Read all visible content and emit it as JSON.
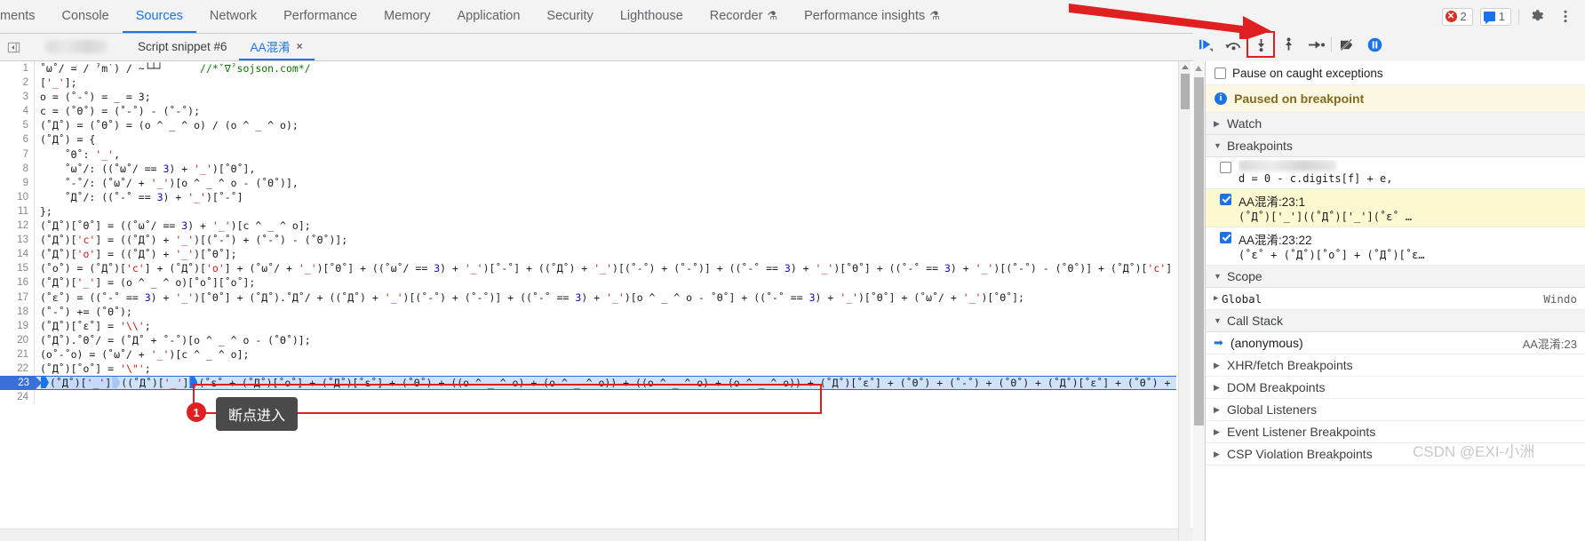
{
  "panel_tabs": [
    {
      "label": "ments",
      "selected": false,
      "clipped": true,
      "flask": false
    },
    {
      "label": "Console",
      "selected": false,
      "flask": false
    },
    {
      "label": "Sources",
      "selected": true,
      "flask": false
    },
    {
      "label": "Network",
      "selected": false,
      "flask": false
    },
    {
      "label": "Performance",
      "selected": false,
      "flask": false
    },
    {
      "label": "Memory",
      "selected": false,
      "flask": false
    },
    {
      "label": "Application",
      "selected": false,
      "flask": false
    },
    {
      "label": "Security",
      "selected": false,
      "flask": false
    },
    {
      "label": "Lighthouse",
      "selected": false,
      "flask": false
    },
    {
      "label": "Recorder",
      "selected": false,
      "flask": true
    },
    {
      "label": "Performance insights",
      "selected": false,
      "flask": true
    }
  ],
  "status_chips": {
    "errors": "2",
    "warnings": "1",
    "error_icon": "error-circle-icon",
    "warning_icon": "message-square-icon"
  },
  "top_actions": {
    "settings_icon": "gear-icon",
    "more_icon": "kebab-menu-icon"
  },
  "file_tabs": [
    {
      "label": "",
      "blurred": true,
      "selected": false,
      "closable": false
    },
    {
      "label": "Script snippet #6",
      "selected": false,
      "closable": false
    },
    {
      "label": "AA混淆",
      "selected": true,
      "closable": true,
      "close_label": "×"
    }
  ],
  "navigator_toggle_icon": "show-navigator-icon",
  "show_debugger_icon": "show-debugger-sidebar-icon",
  "debug_toolbar": [
    {
      "name": "resume-script-execution",
      "icon": "resume-icon",
      "highlighted": false
    },
    {
      "name": "step-over-next-function-call",
      "icon": "step-over-icon",
      "highlighted": false
    },
    {
      "name": "step-into-next-function-call",
      "icon": "step-into-icon",
      "highlighted": true
    },
    {
      "name": "step-out-of-current-function",
      "icon": "step-out-icon",
      "highlighted": false
    },
    {
      "name": "step",
      "icon": "step-icon",
      "highlighted": false
    },
    {
      "name": "deactivate-breakpoints",
      "icon": "deactivate-breakpoints-icon",
      "highlighted": false
    },
    {
      "name": "pause-on-exceptions",
      "icon": "pause-on-exceptions-icon",
      "highlighted": false
    }
  ],
  "code": {
    "lines": [
      {
        "n": "1",
        "text": "˚ω˚/ = / ˀm˙) / ~└┴┘      //*ˇ∇ˀsojson.com*/"
      },
      {
        "n": "2",
        "text": "['_'];"
      },
      {
        "n": "3",
        "text": "o = (˚-˚) = _ = 3;"
      },
      {
        "n": "4",
        "text": "c = (˚Θ˚) = (˚-˚) - (˚-˚);"
      },
      {
        "n": "5",
        "text": "(˚Д˚) = (˚Θ˚) = (o ^ _ ^ o) / (o ^ _ ^ o);"
      },
      {
        "n": "6",
        "text": "(˚Д˚) = {"
      },
      {
        "n": "7",
        "text": "    ˚Θ˚: '_',"
      },
      {
        "n": "8",
        "text": "    ˚ω˚/: ((˚ω˚/ == 3) + '_')[˚Θ˚],"
      },
      {
        "n": "9",
        "text": "    ˚-˚/: (˚ω˚/ + '_')[o ^ _ ^ o - (˚Θ˚)],"
      },
      {
        "n": "10",
        "text": "    ˚Д˚/: ((˚-˚ == 3) + '_')[˚-˚]"
      },
      {
        "n": "11",
        "text": "};"
      },
      {
        "n": "12",
        "text": "(˚Д˚)[˚Θ˚] = ((˚ω˚/ == 3) + '_')[c ^ _ ^ o];"
      },
      {
        "n": "13",
        "text": "(˚Д˚)['c'] = ((˚Д˚) + '_')[(˚-˚) + (˚-˚) - (˚Θ˚)];"
      },
      {
        "n": "14",
        "text": "(˚Д˚)['o'] = ((˚Д˚) + '_')[˚Θ˚];"
      },
      {
        "n": "15",
        "text": "(˚o˚) = (˚Д˚)['c'] + (˚Д˚)['o'] + (˚ω˚/ + '_')[˚Θ˚] + ((˚ω˚/ == 3) + '_')[˚-˚] + ((˚Д˚) + '_')[(˚-˚) + (˚-˚)] + ((˚-˚ == 3) + '_')[˚Θ˚] + ((˚-˚ == 3) + '_')[(˚-˚) - (˚Θ˚)] + (˚Д˚)['c'] +"
      },
      {
        "n": "16",
        "text": "(˚Д˚)['_'] = (o ^ _ ^ o)[˚o˚][˚o˚];"
      },
      {
        "n": "17",
        "text": "(˚ε˚) = ((˚-˚ == 3) + '_')[˚Θ˚] + (˚Д˚).˚Д˚/ + ((˚Д˚) + '_')[(˚-˚) + (˚-˚)] + ((˚-˚ == 3) + '_')[o ^ _ ^ o - ˚Θ˚] + ((˚-˚ == 3) + '_')[˚Θ˚] + (˚ω˚/ + '_')[˚Θ˚];"
      },
      {
        "n": "18",
        "text": "(˚-˚) += (˚Θ˚);"
      },
      {
        "n": "19",
        "text": "(˚Д˚)[˚ε˚] = '\\\\';"
      },
      {
        "n": "20",
        "text": "(˚Д˚).˚Θ˚/ = (˚Д˚ + ˚-˚)[o ^ _ ^ o - (˚Θ˚)];"
      },
      {
        "n": "21",
        "text": "(o˚-˚o) = (˚ω˚/ + '_')[c ^ _ ^ o];"
      },
      {
        "n": "22",
        "text": "(˚Д˚)[˚o˚] = '\\\"';"
      },
      {
        "n": "24",
        "text": ""
      }
    ],
    "paused_line": {
      "n": "23",
      "prefix": "(˚Д˚)['_']",
      "mid": "((˚Д˚)['_']",
      "rest": "(˚ε˚ + (˚Д˚)[˚o˚] + (˚Д˚)[˚ε˚] + (˚Θ˚) + ((o ^ _ ^ o) + (o ^ _ ^ o)) + ((o ^ _ ^ o) + (o ^ _ ^ o))",
      "tail": " + (˚Д˚)[˚ε˚] + (˚Θ˚) + (˚-˚) + (˚Θ˚) + (˚Д˚)[˚ε˚] + (˚Θ˚) + ("
    }
  },
  "sidebar": {
    "pause_on_caught": {
      "label": "Pause on caught exceptions",
      "checked": false
    },
    "paused_banner": {
      "label": "Paused on breakpoint",
      "icon": "info-icon"
    },
    "watch": {
      "label": "Watch",
      "expanded": false
    },
    "breakpoints": {
      "label": "Breakpoints",
      "expanded": true,
      "items": [
        {
          "title": "",
          "blurred": true,
          "code": "d = 0 - c.digits[f] + e,",
          "checked": false,
          "active": false
        },
        {
          "title": "AA混淆:23:1",
          "code": "(˚Д˚)['_']((˚Д˚)['_'](˚ε˚ …",
          "checked": true,
          "active": true
        },
        {
          "title": "AA混淆:23:22",
          "code": "(˚ε˚ + (˚Д˚)[˚o˚] + (˚Д˚)[˚ε…",
          "checked": true,
          "active": false
        }
      ]
    },
    "scope": {
      "label": "Scope",
      "expanded": true,
      "items": [
        {
          "name": "Global",
          "value": "Windo",
          "expanded": false
        }
      ]
    },
    "call_stack": {
      "label": "Call Stack",
      "expanded": true,
      "frames": [
        {
          "name": "(anonymous)",
          "location": "AA混淆:23",
          "current": true
        }
      ]
    },
    "other_sections": [
      {
        "label": "XHR/fetch Breakpoints",
        "expanded": false
      },
      {
        "label": "DOM Breakpoints",
        "expanded": false
      },
      {
        "label": "Global Listeners",
        "expanded": false
      },
      {
        "label": "Event Listener Breakpoints",
        "expanded": false
      },
      {
        "label": "CSP Violation Breakpoints",
        "expanded": false
      }
    ]
  },
  "annotations": {
    "badge_number": "1",
    "callout_text": "断点进入",
    "arrow_color": "#e02020",
    "box_color": "#e02020"
  },
  "watermark": "CSDN @EXI-小洲",
  "colors": {
    "accent": "#1a73e8",
    "error": "#d93025",
    "paused_banner_bg": "#fdf8e3",
    "breakpoint_active_bg": "#fcf8d0",
    "paused_line_bg": "#cfe2fb",
    "annotation_red": "#e02020"
  }
}
